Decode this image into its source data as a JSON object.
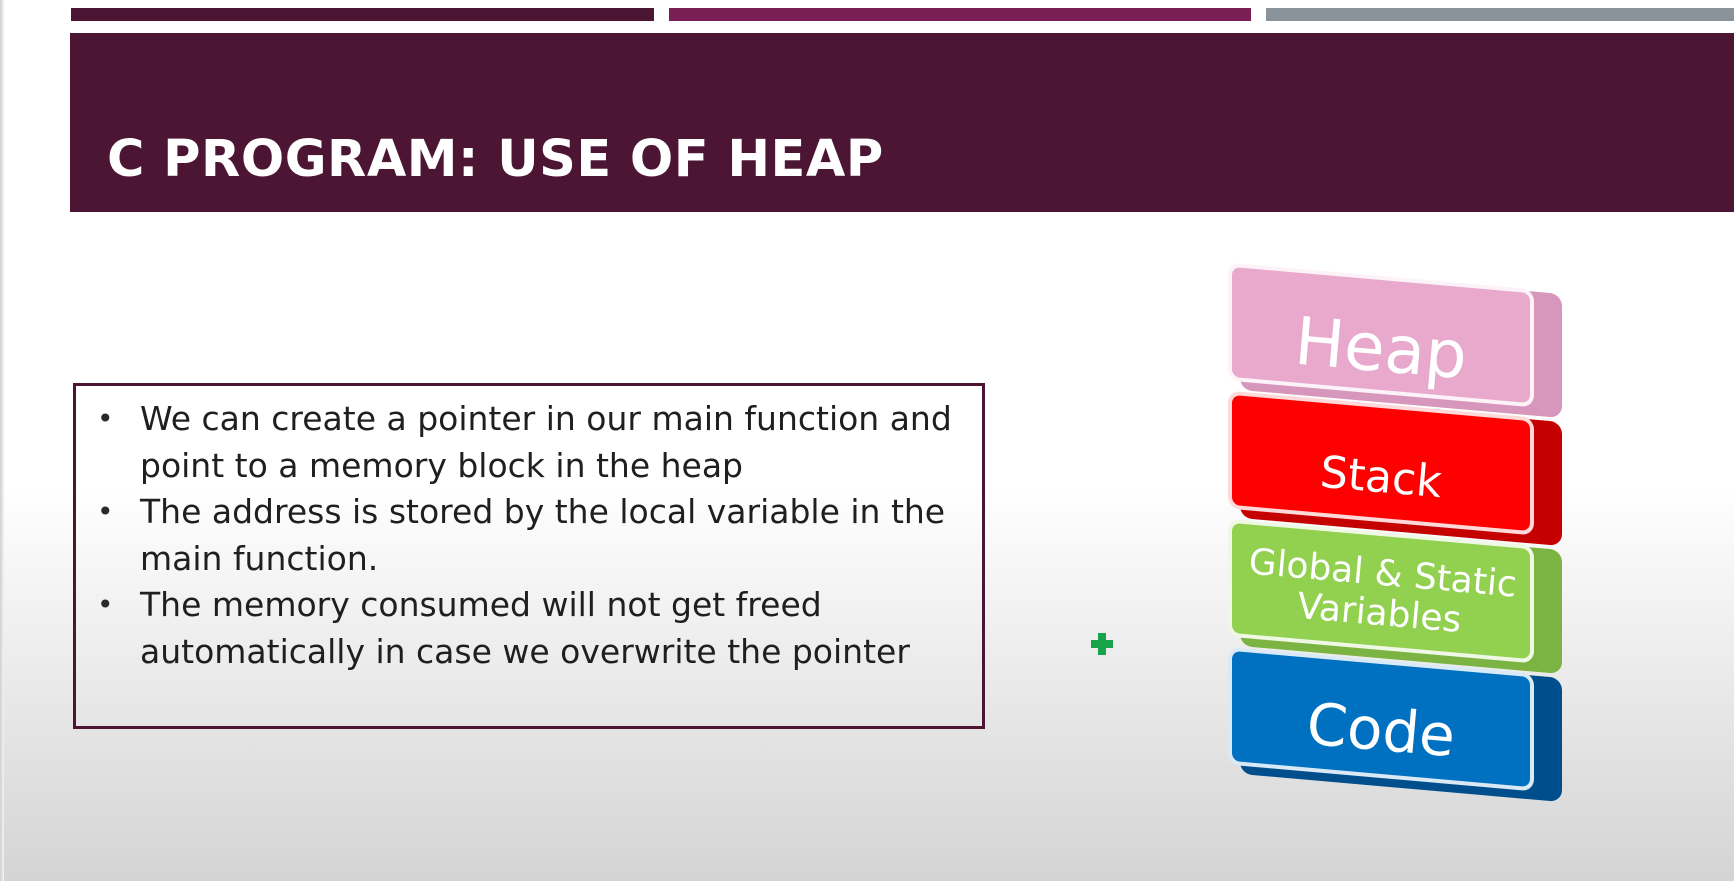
{
  "slide": {
    "title": "C PROGRAM: USE OF HEAP",
    "bullets": [
      {
        "marker": "•",
        "text": "We can create a pointer in our main function and point to a memory block in the heap"
      },
      {
        "marker": "•",
        "text": "The address is stored by the local variable in the main function."
      },
      {
        "marker": "•",
        "text": "The memory consumed will not get freed automatically in case we overwrite the pointer"
      }
    ]
  },
  "diagram": {
    "blocks": [
      {
        "label": "Heap",
        "color": "#e8a9cd"
      },
      {
        "label": "Stack",
        "color": "#ff0000"
      },
      {
        "label": "Global & Static Variables",
        "color": "#92d050"
      },
      {
        "label": "Code",
        "color": "#0070c0"
      }
    ]
  },
  "colors": {
    "title_band": "#4b1533",
    "accent_1": "#4b1533",
    "accent_2": "#7a1f55",
    "accent_3": "#8a9399",
    "cursor": "#18a34a"
  },
  "icons": {
    "cursor": "plus-cursor-icon"
  }
}
